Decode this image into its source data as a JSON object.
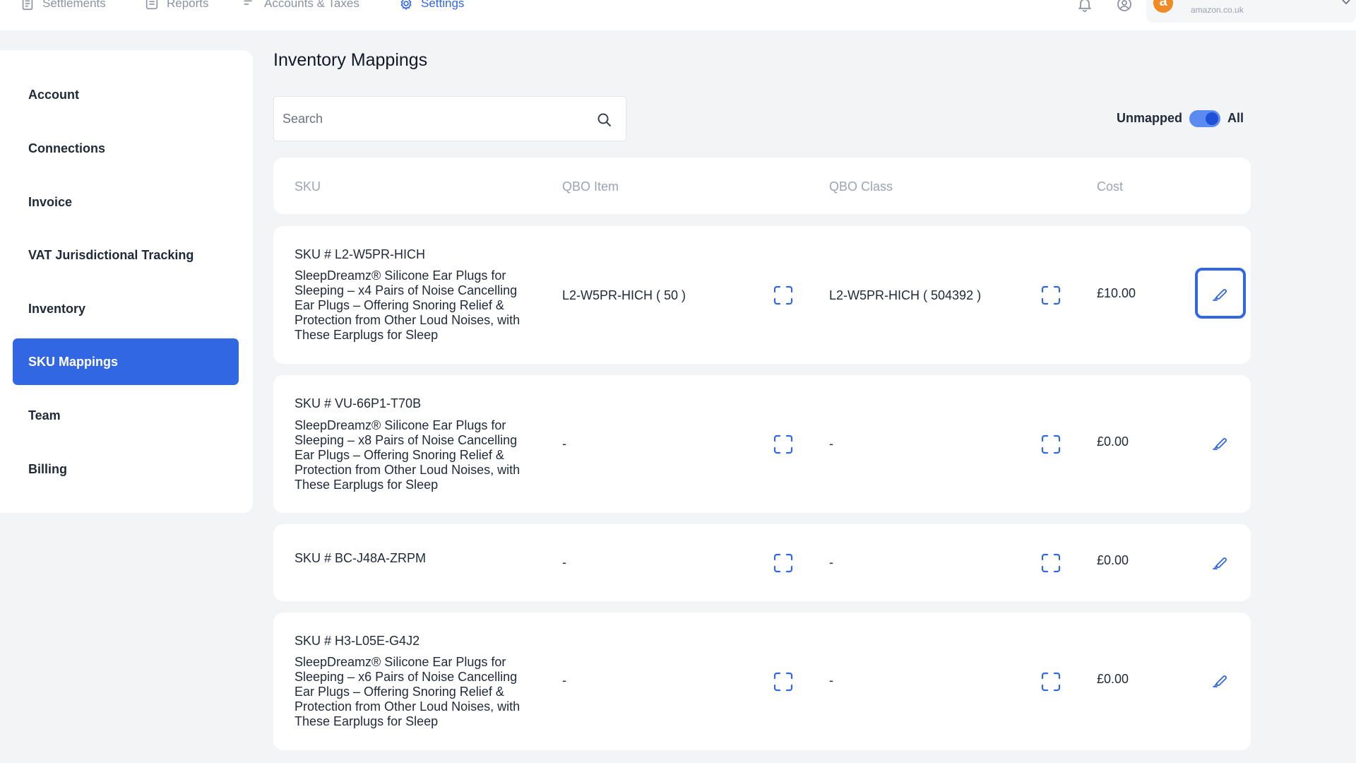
{
  "nav": {
    "items": [
      {
        "label": "Settlements",
        "icon": "document-icon"
      },
      {
        "label": "Reports",
        "icon": "report-icon"
      },
      {
        "label": "Accounts & Taxes",
        "icon": "list-icon"
      },
      {
        "label": "Settings",
        "icon": "gear-icon",
        "active": true
      }
    ],
    "account": {
      "logo_letter": "a",
      "domain": "amazon.co.uk"
    }
  },
  "sidebar": {
    "items": [
      {
        "label": "Account"
      },
      {
        "label": "Connections"
      },
      {
        "label": "Invoice"
      },
      {
        "label": "VAT Jurisdictional Tracking"
      },
      {
        "label": "Inventory"
      },
      {
        "label": "SKU Mappings",
        "active": true
      },
      {
        "label": "Team"
      },
      {
        "label": "Billing"
      }
    ]
  },
  "main": {
    "title": "Inventory Mappings",
    "search": {
      "placeholder": "Search",
      "value": ""
    },
    "filter": {
      "left_label": "Unmapped",
      "right_label": "All",
      "selected": "All"
    },
    "columns": {
      "sku": "SKU",
      "qbo_item": "QBO Item",
      "qbo_class": "QBO Class",
      "cost": "Cost"
    },
    "rows": [
      {
        "sku": "SKU # L2-W5PR-HICH",
        "description": "SleepDreamz® Silicone Ear Plugs for Sleeping – x4 Pairs of Noise Cancelling Ear Plugs – Offering Snoring Relief & Protection from Other Loud Noises, with These Earplugs for Sleep",
        "qbo_item": "L2-W5PR-HICH ( 50 )",
        "qbo_class": "L2-W5PR-HICH ( 504392 )",
        "cost": "£10.00"
      },
      {
        "sku": "SKU # VU-66P1-T70B",
        "description": "SleepDreamz® Silicone Ear Plugs for Sleeping – x8 Pairs of Noise Cancelling Ear Plugs – Offering Snoring Relief & Protection from Other Loud Noises, with These Earplugs for Sleep",
        "qbo_item": "-",
        "qbo_class": "-",
        "cost": "£0.00"
      },
      {
        "sku": "SKU # BC-J48A-ZRPM",
        "description": "",
        "qbo_item": "-",
        "qbo_class": "-",
        "cost": "£0.00"
      },
      {
        "sku": "SKU # H3-L05E-G4J2",
        "description": "SleepDreamz® Silicone Ear Plugs for Sleeping – x6 Pairs of Noise Cancelling Ear Plugs – Offering Snoring Relief & Protection from Other Loud Noises, with These Earplugs for Sleep",
        "qbo_item": "-",
        "qbo_class": "-",
        "cost": "£0.00"
      }
    ]
  },
  "colors": {
    "accent": "#3167e3",
    "background": "#f3f4f6",
    "header_text": "#9aa4b6",
    "amazon_orange": "#f08a24"
  }
}
